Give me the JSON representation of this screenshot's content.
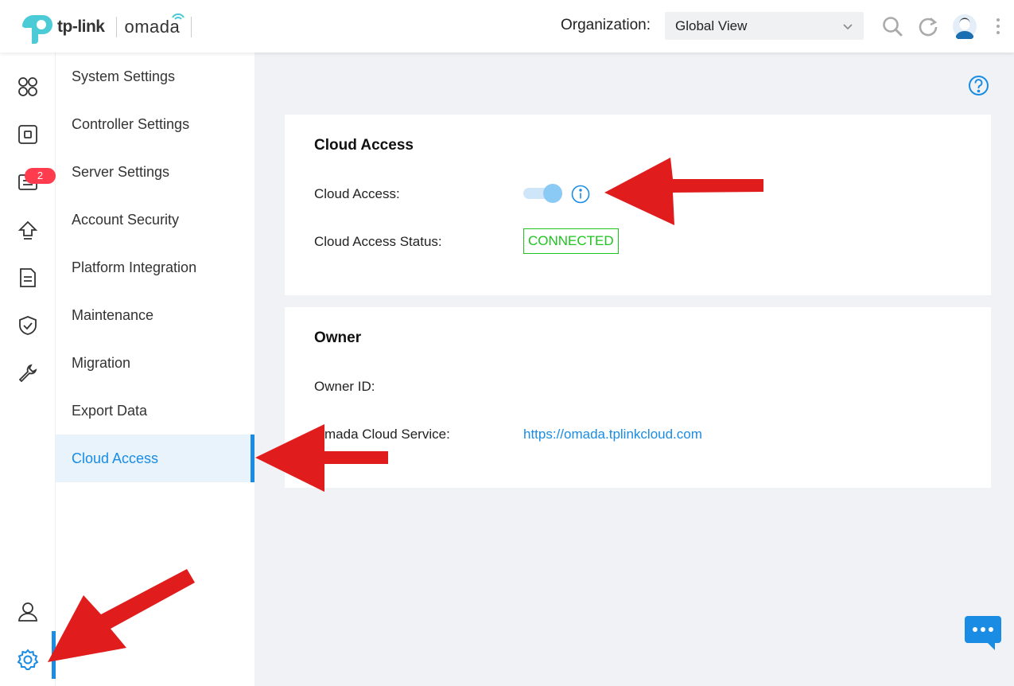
{
  "brand": {
    "tp_link": "tp-link",
    "omada": "omada"
  },
  "header": {
    "org_label": "Organization:",
    "org_value": "Global View",
    "icons": [
      "search-icon",
      "refresh-icon",
      "user-avatar",
      "more-vertical-icon"
    ]
  },
  "rail": {
    "items": [
      "dashboard-icon",
      "devices-icon",
      "alerts-icon",
      "upgrade-icon",
      "logs-icon",
      "security-icon",
      "tools-icon",
      "account-icon",
      "settings-icon"
    ],
    "badge_count": "2",
    "active": "settings-icon"
  },
  "submenu": {
    "items": [
      {
        "label": "System Settings"
      },
      {
        "label": "Controller Settings"
      },
      {
        "label": "Server Settings"
      },
      {
        "label": "Account Security"
      },
      {
        "label": "Platform Integration"
      },
      {
        "label": "Maintenance"
      },
      {
        "label": "Migration"
      },
      {
        "label": "Export Data"
      },
      {
        "label": "Cloud Access"
      }
    ],
    "active": "Cloud Access"
  },
  "cloud_card": {
    "title": "Cloud Access",
    "toggle_label": "Cloud Access",
    "toggle_on": true,
    "status_label": "Cloud Access Status",
    "status_value": "CONNECTED"
  },
  "owner_card": {
    "title": "Owner",
    "owner_id_label": "Owner ID",
    "owner_id_value": "",
    "service_label": "mada Cloud Service",
    "service_link": "https://omada.tplinkcloud.com"
  },
  "colors": {
    "accent": "#1a8ce3",
    "status_green": "#1fc41f",
    "badge_red": "#ff3b4e",
    "annotation_red": "#e01c1c"
  }
}
